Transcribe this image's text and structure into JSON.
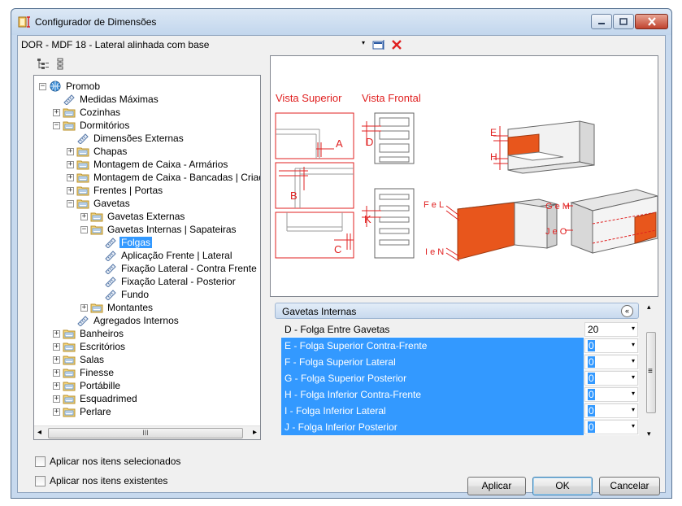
{
  "window": {
    "title": "Configurador de Dimensões",
    "controls": [
      "minimize-icon",
      "maximize-icon",
      "close-icon"
    ]
  },
  "topbar": {
    "title": "DOR - MDF 18 - Lateral alinhada com base",
    "icons": [
      "dropdown-arrow-icon",
      "edit-icon",
      "delete-x-icon"
    ],
    "arrow": "▾"
  },
  "tree": {
    "toolbar_icons": [
      "expand-tree-icon",
      "collapse-tree-icon"
    ],
    "nodes": [
      {
        "label": "Promob",
        "level": 0,
        "expander": "−",
        "icon": "globe-icon"
      },
      {
        "label": "Medidas Máximas",
        "level": 1,
        "expander": "",
        "icon": "ruler-icon"
      },
      {
        "label": "Cozinhas",
        "level": 1,
        "expander": "+",
        "icon": "folder-icon"
      },
      {
        "label": "Dormitórios",
        "level": 1,
        "expander": "−",
        "icon": "folder-icon"
      },
      {
        "label": "Dimensões Externas",
        "level": 2,
        "expander": "",
        "icon": "ruler-icon"
      },
      {
        "label": "Chapas",
        "level": 2,
        "expander": "+",
        "icon": "folder-icon"
      },
      {
        "label": "Montagem de Caixa - Armários",
        "level": 2,
        "expander": "+",
        "icon": "folder-icon"
      },
      {
        "label": "Montagem de Caixa - Bancadas | Criados",
        "level": 2,
        "expander": "+",
        "icon": "folder-icon"
      },
      {
        "label": "Frentes | Portas",
        "level": 2,
        "expander": "+",
        "icon": "folder-icon"
      },
      {
        "label": "Gavetas",
        "level": 2,
        "expander": "−",
        "icon": "folder-icon"
      },
      {
        "label": "Gavetas Externas",
        "level": 3,
        "expander": "+",
        "icon": "folder-icon"
      },
      {
        "label": "Gavetas Internas | Sapateiras",
        "level": 3,
        "expander": "−",
        "icon": "folder-icon"
      },
      {
        "label": "Folgas",
        "level": 4,
        "expander": "",
        "icon": "ruler-icon",
        "selected": true
      },
      {
        "label": "Aplicação Frente | Lateral",
        "level": 4,
        "expander": "",
        "icon": "ruler-icon"
      },
      {
        "label": "Fixação Lateral - Contra Frente",
        "level": 4,
        "expander": "",
        "icon": "ruler-icon"
      },
      {
        "label": "Fixação Lateral - Posterior",
        "level": 4,
        "expander": "",
        "icon": "ruler-icon"
      },
      {
        "label": "Fundo",
        "level": 4,
        "expander": "",
        "icon": "ruler-icon"
      },
      {
        "label": "Montantes",
        "level": 3,
        "expander": "+",
        "icon": "folder-icon"
      },
      {
        "label": "Agregados Internos",
        "level": 2,
        "expander": "",
        "icon": "ruler-icon"
      },
      {
        "label": "Banheiros",
        "level": 1,
        "expander": "+",
        "icon": "folder-icon"
      },
      {
        "label": "Escritórios",
        "level": 1,
        "expander": "+",
        "icon": "folder-icon"
      },
      {
        "label": "Salas",
        "level": 1,
        "expander": "+",
        "icon": "folder-icon"
      },
      {
        "label": "Finesse",
        "level": 1,
        "expander": "+",
        "icon": "folder-icon"
      },
      {
        "label": "Portábille",
        "level": 1,
        "expander": "+",
        "icon": "folder-icon"
      },
      {
        "label": "Esquadrimed",
        "level": 1,
        "expander": "+",
        "icon": "folder-icon"
      },
      {
        "label": "Perlare",
        "level": 1,
        "expander": "+",
        "icon": "folder-icon"
      }
    ],
    "scroll_thumb_glyph": "III",
    "scroll_left": "◂",
    "scroll_right": "▸"
  },
  "diagram": {
    "labels": {
      "vista_superior": "Vista Superior",
      "vista_frontal": "Vista Frontal",
      "A": "A",
      "B": "B",
      "C": "C",
      "D": "D",
      "E": "E",
      "H": "H",
      "K": "K",
      "FeL": "F e L",
      "IeN": "I e N",
      "GeM": "G e M",
      "JeO": "J e O"
    },
    "accent_color": "#e8561c",
    "line_color": "#e02020"
  },
  "property_grid": {
    "category": "Gavetas Internas",
    "collapse_glyph": "«",
    "rows": [
      {
        "label": "D - Folga Entre Gavetas",
        "value": "20",
        "highlighted": false
      },
      {
        "label": "E - Folga Superior Contra-Frente",
        "value": "0",
        "highlighted": true
      },
      {
        "label": "F - Folga Superior Lateral",
        "value": "0",
        "highlighted": true
      },
      {
        "label": "G - Folga Superior Posterior",
        "value": "0",
        "highlighted": true
      },
      {
        "label": "H - Folga Inferior Contra-Frente",
        "value": "0",
        "highlighted": true
      },
      {
        "label": "I - Folga Inferior Lateral",
        "value": "0",
        "highlighted": true
      },
      {
        "label": "J - Folga Inferior Posterior",
        "value": "0",
        "highlighted": true
      }
    ],
    "dropdown_glyph": "▾",
    "scroll_up": "▴",
    "scroll_down": "▾",
    "thumb_grip": "≡"
  },
  "options": {
    "apply_selected": "Aplicar nos itens selecionados",
    "apply_existing": "Aplicar nos itens existentes"
  },
  "buttons": {
    "apply": "Aplicar",
    "ok": "OK",
    "cancel": "Cancelar"
  }
}
